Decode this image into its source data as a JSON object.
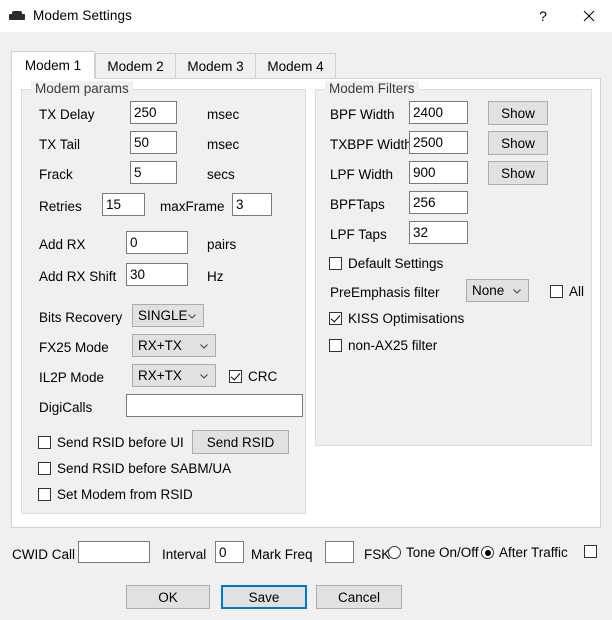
{
  "window": {
    "title": "Modem Settings",
    "icon": "modem-icon",
    "help_label": "?",
    "close_label": "✕"
  },
  "tabs": [
    {
      "label": "Modem 1",
      "active": true
    },
    {
      "label": "Modem 2",
      "active": false
    },
    {
      "label": "Modem 3",
      "active": false
    },
    {
      "label": "Modem 4",
      "active": false
    }
  ],
  "modem_params": {
    "title": "Modem params",
    "tx_delay": {
      "label": "TX Delay",
      "value": "250",
      "unit": "msec"
    },
    "tx_tail": {
      "label": "TX Tail",
      "value": "50",
      "unit": "msec"
    },
    "frack": {
      "label": "Frack",
      "value": "5",
      "unit": "secs"
    },
    "retries": {
      "label": "Retries",
      "value": "15"
    },
    "max_frame": {
      "label": "maxFrame",
      "value": "3"
    },
    "add_rx": {
      "label": "Add RX",
      "value": "0",
      "unit": "pairs"
    },
    "add_rx_shift": {
      "label": "Add RX Shift",
      "value": "30",
      "unit": "Hz"
    },
    "bits_recovery": {
      "label": "Bits Recovery",
      "value": "SINGLE"
    },
    "fx25_mode": {
      "label": "FX25 Mode",
      "value": "RX+TX"
    },
    "il2p_mode": {
      "label": "IL2P  Mode",
      "value": "RX+TX"
    },
    "crc": {
      "label": "CRC",
      "checked": true
    },
    "digicalls": {
      "label": "DigiCalls",
      "value": ""
    },
    "send_rsid_before_ui": {
      "label": "Send RSID before UI",
      "checked": false
    },
    "send_rsid_button": {
      "label": "Send RSID"
    },
    "send_rsid_before_sabm": {
      "label": "Send RSID before SABM/UA",
      "checked": false
    },
    "set_modem_from_rsid": {
      "label": "Set Modem from RSID",
      "checked": false
    }
  },
  "modem_filters": {
    "title": "Modem Filters",
    "bpf_width": {
      "label": "BPF Width",
      "value": "2400",
      "button": "Show"
    },
    "txbpf_width": {
      "label": "TXBPF Width",
      "value": "2500",
      "button": "Show"
    },
    "lpf_width": {
      "label": "LPF Width",
      "value": "900",
      "button": "Show"
    },
    "bpf_taps": {
      "label": "BPFTaps",
      "value": "256"
    },
    "lpf_taps": {
      "label": "LPF Taps",
      "value": "32"
    },
    "default_settings": {
      "label": "Default Settings",
      "checked": false
    },
    "preemphasis": {
      "label": "PreEmphasis filter",
      "value": "None"
    },
    "preemphasis_all": {
      "label": "All",
      "checked": false
    },
    "kiss_optimisations": {
      "label": "KISS Optimisations",
      "checked": true
    },
    "non_ax25_filter": {
      "label": "non-AX25 filter",
      "checked": false
    }
  },
  "footer": {
    "cwid_call": {
      "label": "CWID Call",
      "value": ""
    },
    "interval": {
      "label": "Interval",
      "value": "0"
    },
    "mark_freq": {
      "label": "Mark Freq",
      "value": ""
    },
    "fsk": {
      "label": "FSK",
      "checked": false
    },
    "tone_on_off": {
      "label": "Tone On/Off",
      "checked": false
    },
    "after_traffic": {
      "label": "After Traffic",
      "checked": true
    },
    "trailing_checkbox": {
      "label": "",
      "checked": false
    }
  },
  "dialog_buttons": {
    "ok": "OK",
    "save": "Save",
    "cancel": "Cancel"
  },
  "colors": {
    "accent": "#0078d7",
    "window_bg": "#f0f0f0",
    "panel_bg": "#ffffff",
    "field_border": "#7a7a7a"
  }
}
